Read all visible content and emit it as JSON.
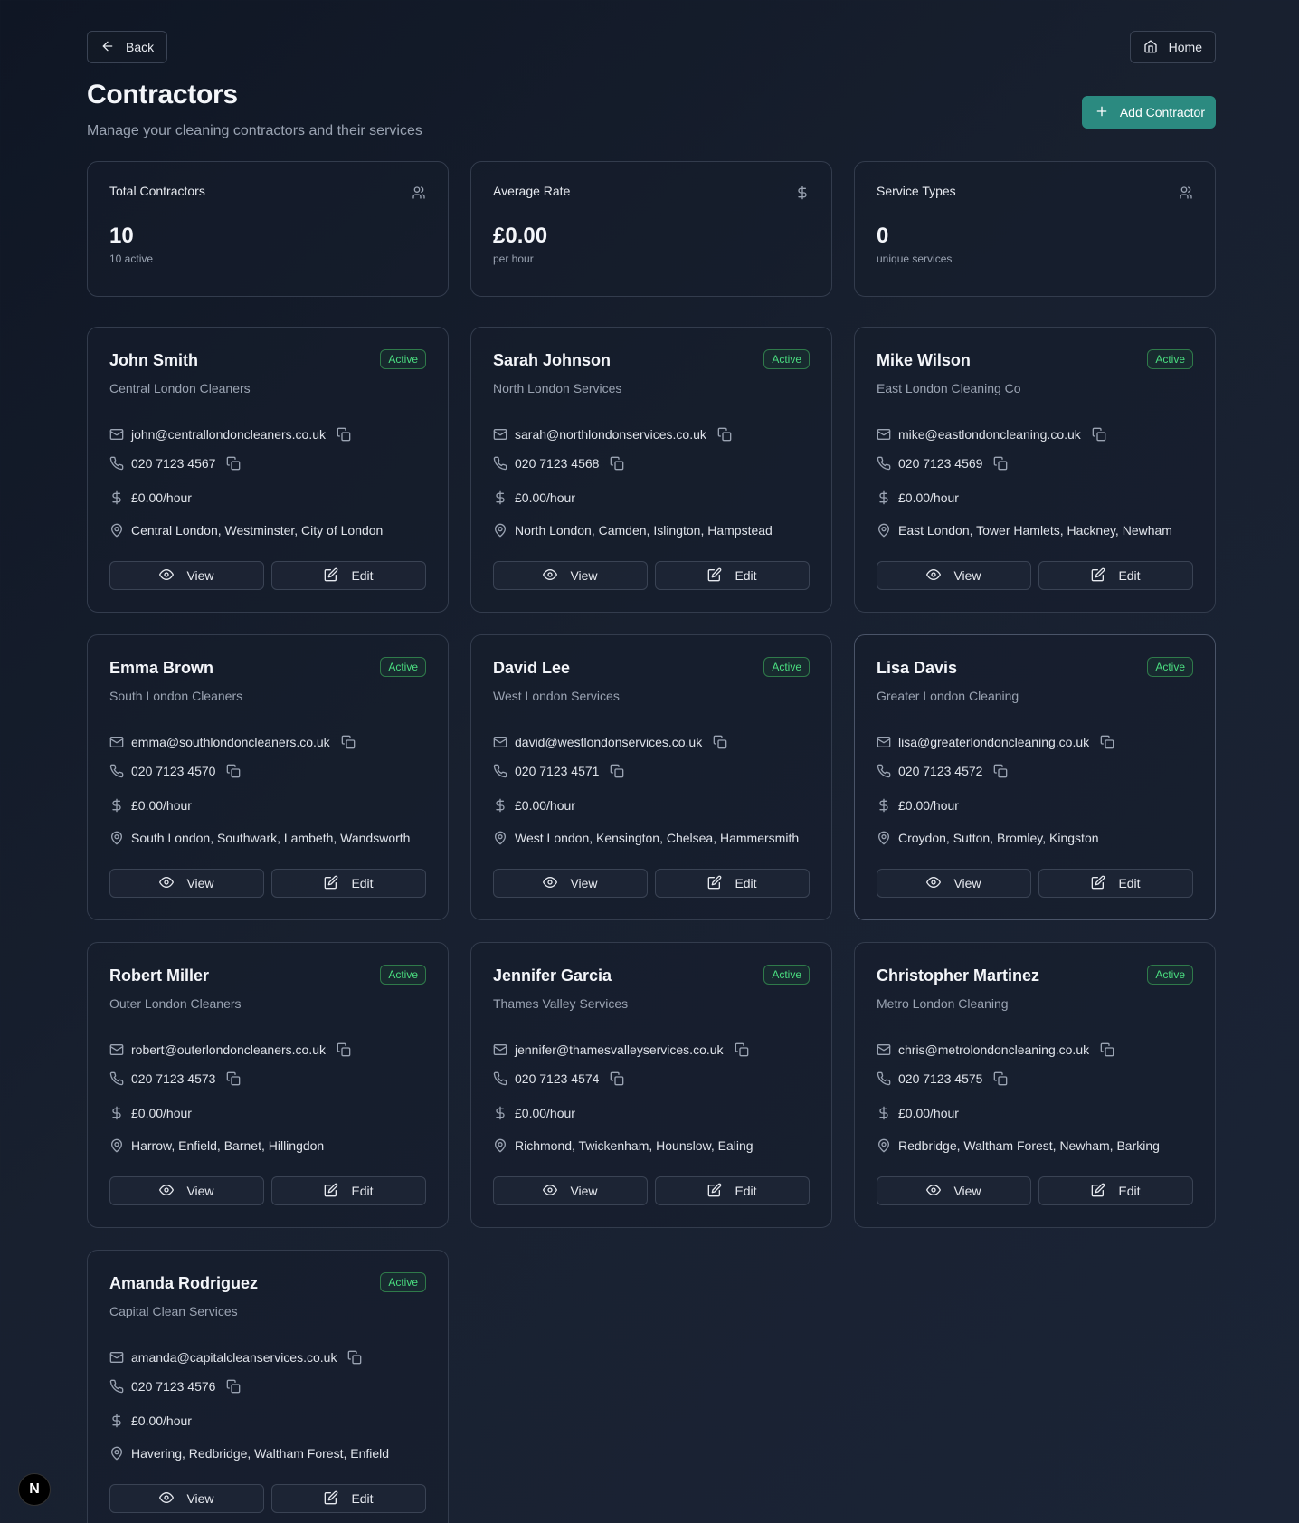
{
  "nav": {
    "back_label": "Back",
    "home_label": "Home"
  },
  "header": {
    "title": "Contractors",
    "subtitle": "Manage your cleaning contractors and their services",
    "add_label": "Add Contractor"
  },
  "stats": [
    {
      "label": "Total Contractors",
      "value": "10",
      "sub": "10 active",
      "icon": "users-icon"
    },
    {
      "label": "Average Rate",
      "value": "£0.00",
      "sub": "per hour",
      "icon": "dollar-icon"
    },
    {
      "label": "Service Types",
      "value": "0",
      "sub": "unique services",
      "icon": "users-icon"
    }
  ],
  "contractors": [
    {
      "name": "John Smith",
      "company": "Central London Cleaners",
      "status": "Active",
      "email": "john@centrallondoncleaners.co.uk",
      "phone": "020 7123 4567",
      "rate": "£0.00/hour",
      "areas": "Central London, Westminster, City of London"
    },
    {
      "name": "Sarah Johnson",
      "company": "North London Services",
      "status": "Active",
      "email": "sarah@northlondonservices.co.uk",
      "phone": "020 7123 4568",
      "rate": "£0.00/hour",
      "areas": "North London, Camden, Islington, Hampstead"
    },
    {
      "name": "Mike Wilson",
      "company": "East London Cleaning Co",
      "status": "Active",
      "email": "mike@eastlondoncleaning.co.uk",
      "phone": "020 7123 4569",
      "rate": "£0.00/hour",
      "areas": "East London, Tower Hamlets, Hackney, Newham"
    },
    {
      "name": "Emma Brown",
      "company": "South London Cleaners",
      "status": "Active",
      "email": "emma@southlondoncleaners.co.uk",
      "phone": "020 7123 4570",
      "rate": "£0.00/hour",
      "areas": "South London, Southwark, Lambeth, Wandsworth"
    },
    {
      "name": "David Lee",
      "company": "West London Services",
      "status": "Active",
      "email": "david@westlondonservices.co.uk",
      "phone": "020 7123 4571",
      "rate": "£0.00/hour",
      "areas": "West London, Kensington, Chelsea, Hammersmith"
    },
    {
      "name": "Lisa Davis",
      "company": "Greater London Cleaning",
      "status": "Active",
      "email": "lisa@greaterlondoncleaning.co.uk",
      "phone": "020 7123 4572",
      "rate": "£0.00/hour",
      "areas": "Croydon, Sutton, Bromley, Kingston"
    },
    {
      "name": "Robert Miller",
      "company": "Outer London Cleaners",
      "status": "Active",
      "email": "robert@outerlondoncleaners.co.uk",
      "phone": "020 7123 4573",
      "rate": "£0.00/hour",
      "areas": "Harrow, Enfield, Barnet, Hillingdon"
    },
    {
      "name": "Jennifer Garcia",
      "company": "Thames Valley Services",
      "status": "Active",
      "email": "jennifer@thamesvalleyservices.co.uk",
      "phone": "020 7123 4574",
      "rate": "£0.00/hour",
      "areas": "Richmond, Twickenham, Hounslow, Ealing"
    },
    {
      "name": "Christopher Martinez",
      "company": "Metro London Cleaning",
      "status": "Active",
      "email": "chris@metrolondoncleaning.co.uk",
      "phone": "020 7123 4575",
      "rate": "£0.00/hour",
      "areas": "Redbridge, Waltham Forest, Newham, Barking"
    },
    {
      "name": "Amanda Rodriguez",
      "company": "Capital Clean Services",
      "status": "Active",
      "email": "amanda@capitalcleanservices.co.uk",
      "phone": "020 7123 4576",
      "rate": "£0.00/hour",
      "areas": "Havering, Redbridge, Waltham Forest, Enfield"
    }
  ],
  "card_actions": {
    "view_label": "View",
    "edit_label": "Edit"
  },
  "dev_badge": {
    "letter": "N"
  }
}
